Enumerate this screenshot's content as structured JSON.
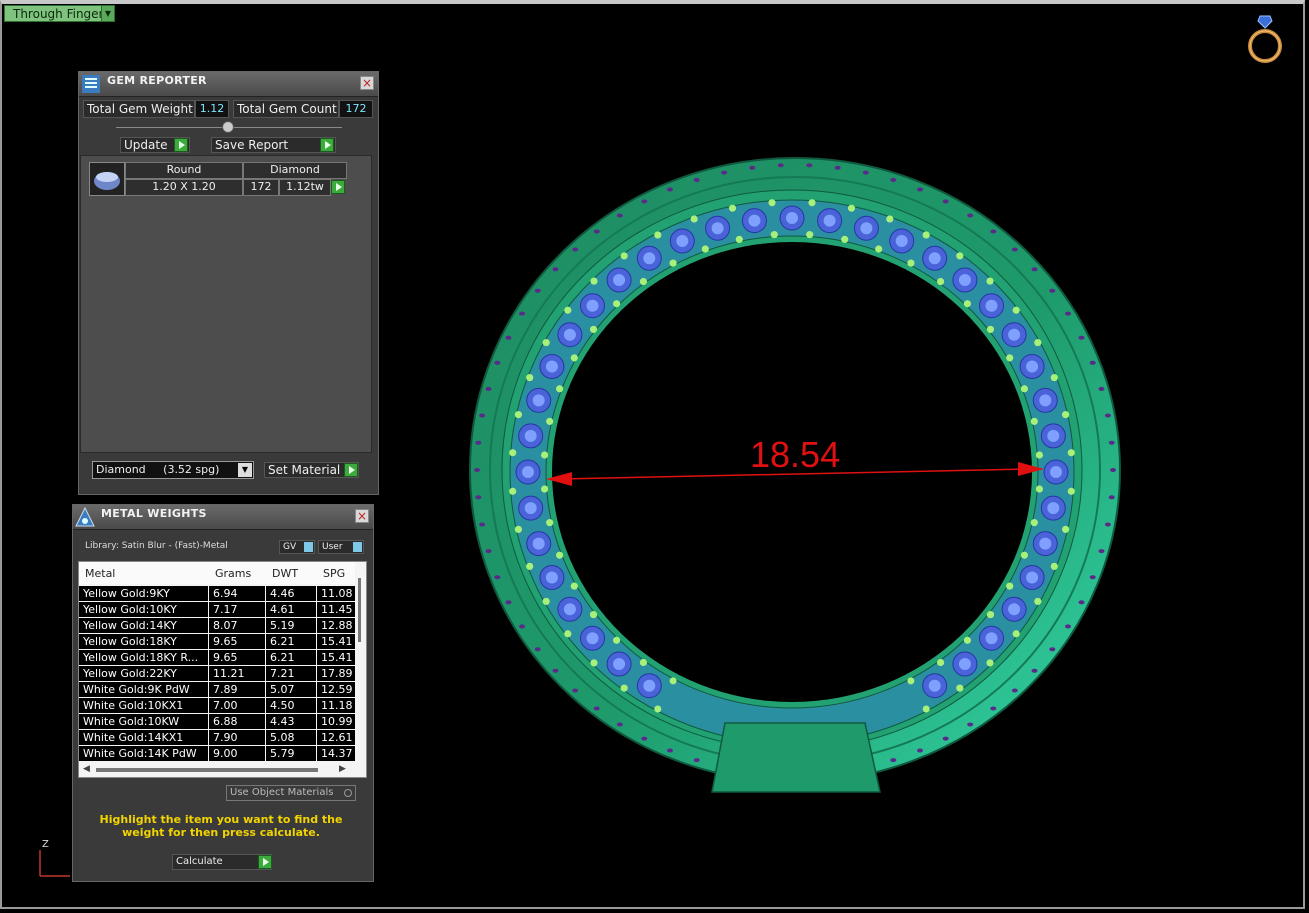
{
  "viewport": {
    "mode_label": "Through Finger",
    "dimension_value": "18.54",
    "axis_label": "Z"
  },
  "gem_reporter": {
    "title": "GEM REPORTER",
    "total_weight_label": "Total Gem Weight",
    "total_weight_value": "1.12",
    "total_count_label": "Total Gem Count",
    "total_count_value": "172",
    "update_label": "Update",
    "save_report_label": "Save Report",
    "row": {
      "shape": "Round",
      "size": "1.20 X 1.20",
      "material": "Diamond",
      "count": "172",
      "weight": "1.12tw"
    },
    "material_select": "Diamond     (3.52 spg)",
    "set_material_label": "Set Material"
  },
  "metal_weights": {
    "title": "METAL WEIGHTS",
    "library": "Library: Satin Blur - (Fast)-Metal",
    "gv_label": "GV",
    "user_label": "User",
    "columns": [
      "Metal",
      "Grams",
      "DWT",
      "SPG"
    ],
    "rows": [
      [
        "Yellow Gold:9KY",
        "6.94",
        "4.46",
        "11.08"
      ],
      [
        "Yellow Gold:10KY",
        "7.17",
        "4.61",
        "11.45"
      ],
      [
        "Yellow Gold:14KY",
        "8.07",
        "5.19",
        "12.88"
      ],
      [
        "Yellow Gold:18KY",
        "9.65",
        "6.21",
        "15.41"
      ],
      [
        "Yellow Gold:18KY R...",
        "9.65",
        "6.21",
        "15.41"
      ],
      [
        "Yellow Gold:22KY",
        "11.21",
        "7.21",
        "17.89"
      ],
      [
        "White Gold:9K PdW",
        "7.89",
        "5.07",
        "12.59"
      ],
      [
        "White Gold:10KX1",
        "7.00",
        "4.50",
        "11.18"
      ],
      [
        "White Gold:10KW",
        "6.88",
        "4.43",
        "10.99"
      ],
      [
        "White Gold:14KX1",
        "7.90",
        "5.08",
        "12.61"
      ],
      [
        "White Gold:14K PdW",
        "9.00",
        "5.79",
        "14.37"
      ]
    ],
    "use_object_materials": "Use Object Materials",
    "note": "Highlight the item you want to find the weight for then press calculate.",
    "calculate_label": "Calculate"
  },
  "colors": {
    "ring_green": "#1f9a6a",
    "gem_blue": "#4a63d8",
    "prong_green": "#a8f07a",
    "dimension_red": "#e01010"
  }
}
